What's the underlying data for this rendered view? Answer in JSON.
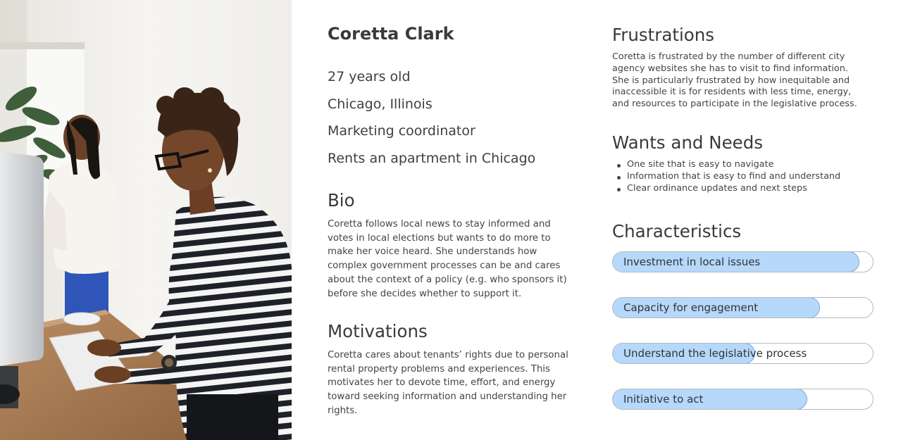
{
  "persona": {
    "name": "Coretta Clark",
    "facts": [
      "27 years old",
      "Chicago, Illinois",
      "Marketing coordinator",
      "Rents an apartment in Chicago"
    ]
  },
  "bio": {
    "heading": "Bio",
    "text": "Coretta follows local news to stay informed and votes in local elections but wants to do more to make her voice heard. She understands how complex government processes can be and cares about the context of a policy (e.g. who sponsors it) before she decides whether to support it."
  },
  "motivations": {
    "heading": "Motivations",
    "text": "Coretta cares about tenants’ rights due to personal rental property problems and experiences. This motivates her to devote time, effort, and energy toward seeking information and understanding her rights."
  },
  "frustrations": {
    "heading": "Frustrations",
    "text": "Coretta is frustrated by the number of different city agency websites she has to visit to find information. She is particularly frustrated by how inequitable and inaccessible it is for residents with less time, energy, and resources to participate in the legislative process."
  },
  "wants_needs": {
    "heading": "Wants and Needs",
    "items": [
      "One site that is easy to navigate",
      "Information that is easy to find and understand",
      "Clear ordinance updates and next steps"
    ]
  },
  "characteristics": {
    "heading": "Characteristics",
    "bars": [
      {
        "label": "Investment in local issues",
        "level": 0.95
      },
      {
        "label": "Capacity for engagement",
        "level": 0.8
      },
      {
        "label": "Understand the legislative process",
        "level": 0.55
      },
      {
        "label": "Initiative to act",
        "level": 0.75
      }
    ]
  },
  "colors": {
    "bar_fill": "#b6d8fb",
    "bar_border": "#7fa9d9",
    "track_border": "#b9b9b9",
    "text": "#3f3f3f"
  }
}
